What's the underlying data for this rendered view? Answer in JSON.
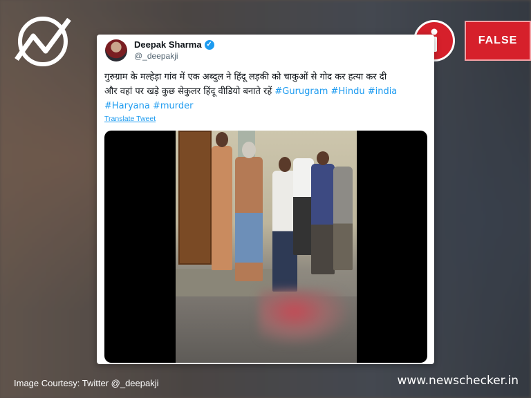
{
  "tweet": {
    "author_name": "Deepak Sharma",
    "handle": "@_deepakji",
    "text_line1": "गुरुग्राम के मल्हेड़ा गांव में एक अब्दुल ने हिंदू लड़की को चाकुओं से गोद कर हत्या कर दी",
    "text_line2": "और वहां पर खड़े कुछ सेकुलर हिंदू वीडियो बनाते रहें",
    "hashtags_line2": [
      "#Gurugram",
      "#Hindu",
      "#india"
    ],
    "hashtags_line3": [
      "#Haryana",
      "#murder"
    ],
    "translate_label": "Translate Tweet"
  },
  "verdict": {
    "label": "FALSE",
    "color": "#d6202b"
  },
  "icons": [
    "newschecker-logo-icon",
    "info-icon",
    "verified-badge-icon"
  ],
  "footer": {
    "image_courtesy": "Image Courtesy: Twitter @_deepakji",
    "site": "www.newschecker.in"
  }
}
